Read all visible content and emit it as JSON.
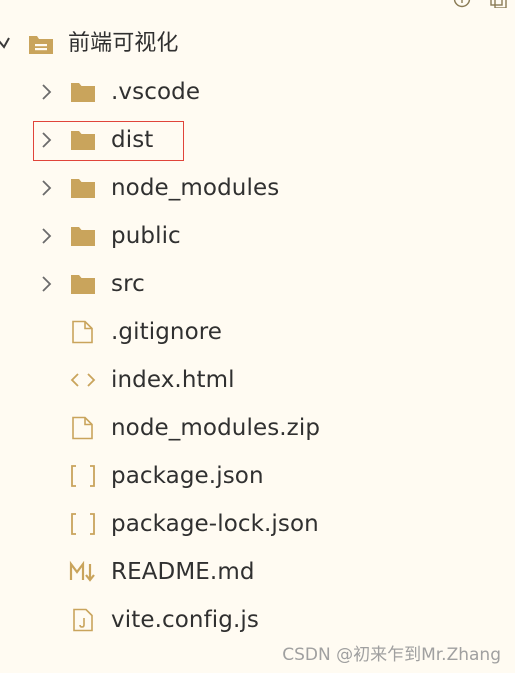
{
  "root": {
    "label": "前端可视化",
    "icon": "folder-open-icon",
    "expanded": true
  },
  "items": [
    {
      "label": ".vscode",
      "kind": "folder",
      "icon": "folder-icon"
    },
    {
      "label": "dist",
      "kind": "folder",
      "icon": "folder-icon",
      "highlighted": true
    },
    {
      "label": "node_modules",
      "kind": "folder",
      "icon": "folder-icon"
    },
    {
      "label": "public",
      "kind": "folder",
      "icon": "folder-icon"
    },
    {
      "label": "src",
      "kind": "folder",
      "icon": "folder-icon"
    },
    {
      "label": ".gitignore",
      "kind": "file",
      "icon": "file-icon"
    },
    {
      "label": "index.html",
      "kind": "file",
      "icon": "html-code-icon"
    },
    {
      "label": "node_modules.zip",
      "kind": "file",
      "icon": "file-icon"
    },
    {
      "label": "package.json",
      "kind": "file",
      "icon": "json-brackets-icon"
    },
    {
      "label": "package-lock.json",
      "kind": "file",
      "icon": "json-brackets-icon"
    },
    {
      "label": "README.md",
      "kind": "file",
      "icon": "markdown-icon"
    },
    {
      "label": "vite.config.js",
      "kind": "file",
      "icon": "js-file-icon"
    }
  ],
  "watermark": "CSDN @初来乍到Mr.Zhang",
  "colors": {
    "background": "#fffbf2",
    "folder": "#c9a45c",
    "icon_stroke": "#c9a45c",
    "chevron": "#6b6b6b",
    "highlight_border": "#e0443a"
  }
}
